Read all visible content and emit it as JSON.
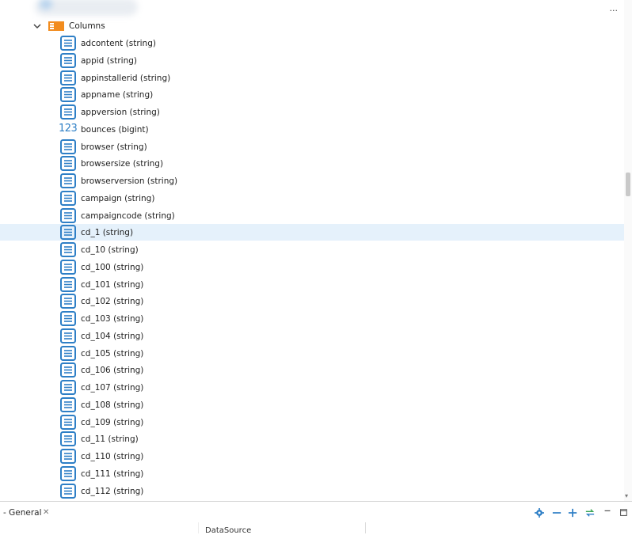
{
  "tree": {
    "columns_node": {
      "label": "Columns",
      "expanded": true
    },
    "overflow_menu": "...",
    "rows": [
      {
        "label": "adcontent (string)",
        "type": "string"
      },
      {
        "label": "appid (string)",
        "type": "string"
      },
      {
        "label": "appinstallerid (string)",
        "type": "string"
      },
      {
        "label": "appname (string)",
        "type": "string"
      },
      {
        "label": "appversion (string)",
        "type": "string"
      },
      {
        "label": "bounces (bigint)",
        "type": "number",
        "icon_text": "123"
      },
      {
        "label": "browser (string)",
        "type": "string"
      },
      {
        "label": "browsersize (string)",
        "type": "string"
      },
      {
        "label": "browserversion (string)",
        "type": "string"
      },
      {
        "label": "campaign (string)",
        "type": "string"
      },
      {
        "label": "campaigncode (string)",
        "type": "string"
      },
      {
        "label": "cd_1 (string)",
        "type": "string",
        "selected": true
      },
      {
        "label": "cd_10 (string)",
        "type": "string"
      },
      {
        "label": "cd_100 (string)",
        "type": "string"
      },
      {
        "label": "cd_101 (string)",
        "type": "string"
      },
      {
        "label": "cd_102 (string)",
        "type": "string"
      },
      {
        "label": "cd_103 (string)",
        "type": "string"
      },
      {
        "label": "cd_104 (string)",
        "type": "string"
      },
      {
        "label": "cd_105 (string)",
        "type": "string"
      },
      {
        "label": "cd_106 (string)",
        "type": "string"
      },
      {
        "label": "cd_107 (string)",
        "type": "string"
      },
      {
        "label": "cd_108 (string)",
        "type": "string"
      },
      {
        "label": "cd_109 (string)",
        "type": "string"
      },
      {
        "label": "cd_11 (string)",
        "type": "string"
      },
      {
        "label": "cd_110 (string)",
        "type": "string"
      },
      {
        "label": "cd_111 (string)",
        "type": "string"
      },
      {
        "label": "cd_112 (string)",
        "type": "string"
      }
    ]
  },
  "bottom_panel": {
    "tab_label": "- General",
    "close_glyph": "✕",
    "subheader": "DataSource"
  },
  "colors": {
    "column_icon": "#2e7fc6",
    "folder_icon": "#f28c1e",
    "selection": "#e5f1fb",
    "toolbar_blue": "#2e7fc6",
    "toolbar_green": "#3aa655"
  }
}
